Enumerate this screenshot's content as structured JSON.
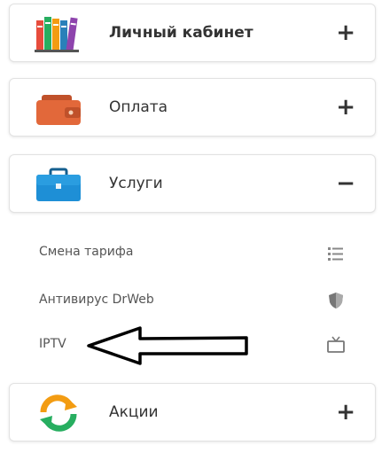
{
  "menu": {
    "items": [
      {
        "label": "Личный кабинет",
        "toggle": "+",
        "icon": "books-icon"
      },
      {
        "label": "Оплата",
        "toggle": "+",
        "icon": "wallet-icon"
      },
      {
        "label": "Услуги",
        "toggle": "−",
        "icon": "briefcase-icon"
      },
      {
        "label": "Акции",
        "toggle": "+",
        "icon": "refresh-icon"
      }
    ],
    "services_submenu": [
      {
        "label": "Смена тарифа",
        "icon": "list-icon"
      },
      {
        "label": "Антивирус DrWeb",
        "icon": "shield-icon"
      },
      {
        "label": "IPTV",
        "icon": "tv-icon"
      }
    ]
  },
  "annotation": {
    "arrow": "left-arrow-annotation"
  },
  "colors": {
    "wallet": "#e2683a",
    "briefcase": "#1e8fd6",
    "refresh_orange": "#f39c12",
    "refresh_green": "#27ae60"
  }
}
